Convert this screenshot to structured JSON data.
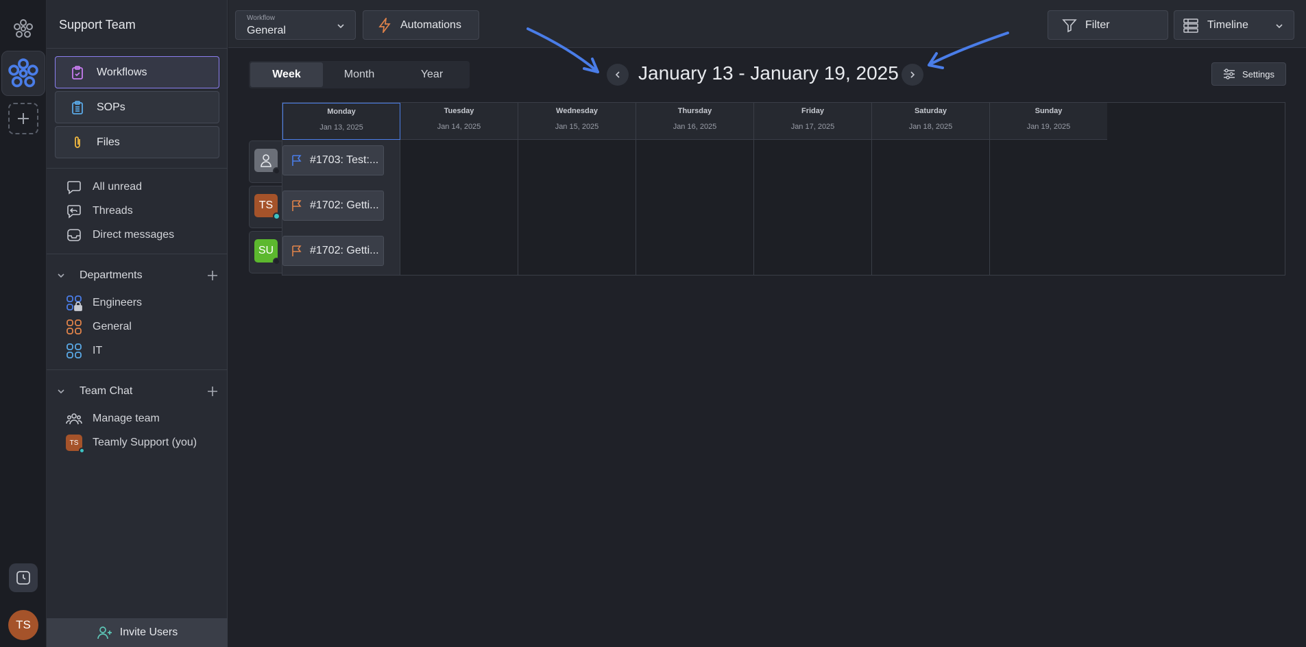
{
  "rail": {
    "avatar_initials": "TS"
  },
  "sidebar": {
    "team_name": "Support Team",
    "nav_cards": [
      {
        "label": "Workflows",
        "icon": "clipboard-check-icon"
      },
      {
        "label": "SOPs",
        "icon": "clipboard-list-icon"
      },
      {
        "label": "Files",
        "icon": "paperclip-icon"
      }
    ],
    "items": [
      {
        "label": "All unread",
        "icon": "chat-bubble-icon"
      },
      {
        "label": "Threads",
        "icon": "threads-icon"
      },
      {
        "label": "Direct messages",
        "icon": "inbox-icon"
      }
    ],
    "departments": {
      "title": "Departments",
      "items": [
        {
          "label": "Engineers",
          "color": "#4a7de8",
          "locked": true
        },
        {
          "label": "General",
          "color": "#e0834a"
        },
        {
          "label": "IT",
          "color": "#5aa9e6"
        }
      ]
    },
    "team_chat": {
      "title": "Team Chat",
      "manage": "Manage team",
      "member": "Teamly Support (you)",
      "member_initials": "TS"
    },
    "invite_label": "Invite Users"
  },
  "topbar": {
    "workflow_small": "Workflow",
    "workflow_value": "General",
    "automations": "Automations",
    "filter": "Filter",
    "view": "Timeline"
  },
  "calendar": {
    "views": [
      "Week",
      "Month",
      "Year"
    ],
    "active_view": "Week",
    "range": "January 13 - January 19, 2025",
    "settings": "Settings",
    "days": [
      {
        "name": "Monday",
        "date": "Jan 13, 2025"
      },
      {
        "name": "Tuesday",
        "date": "Jan 14, 2025"
      },
      {
        "name": "Wednesday",
        "date": "Jan 15, 2025"
      },
      {
        "name": "Thursday",
        "date": "Jan 16, 2025"
      },
      {
        "name": "Friday",
        "date": "Jan 17, 2025"
      },
      {
        "name": "Saturday",
        "date": "Jan 18, 2025"
      },
      {
        "name": "Sunday",
        "date": "Jan 19, 2025"
      }
    ],
    "rows": [
      {
        "avatar": "",
        "avatar_color": "#6b6f78",
        "status_color": "#1f2128",
        "task": "#1703: Test:...",
        "flag_color": "#4a7de8"
      },
      {
        "avatar": "TS",
        "avatar_color": "#a5532a",
        "status_color": "#3dc4c4",
        "task": "#1702: Getti...",
        "flag_color": "#e0834a"
      },
      {
        "avatar": "SU",
        "avatar_color": "#5cb82e",
        "status_color": "#1f2128",
        "task": "#1702: Getti...",
        "flag_color": "#e0834a"
      }
    ]
  },
  "colors": {
    "accent": "#4a7de8",
    "active_border": "#8b7ff0",
    "annotation_arrow": "#4a7de8"
  }
}
